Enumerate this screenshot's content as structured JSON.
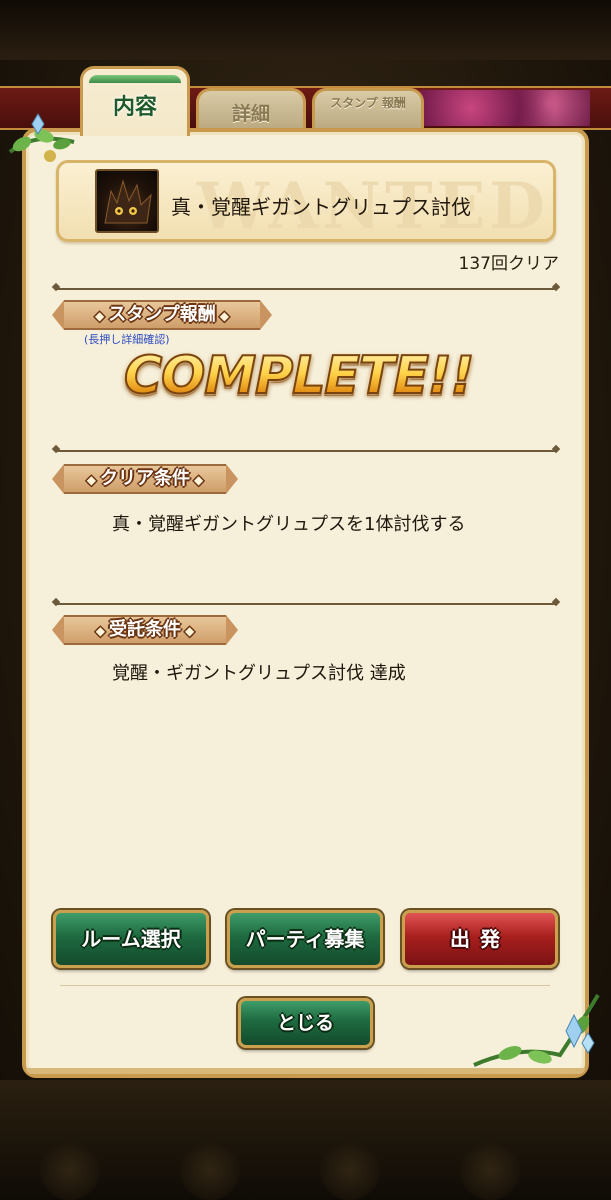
{
  "tabs": [
    {
      "label": "内容",
      "active": true
    },
    {
      "label": "詳細",
      "active": false
    },
    {
      "label": "スタンプ 報酬",
      "active": false
    }
  ],
  "quest": {
    "title": "真・覚醒ギガントグリュプス討伐",
    "watermark": "WANTED",
    "clear_count": "137回クリア"
  },
  "stamp_reward": {
    "heading": "スタンプ報酬",
    "hint": "(長押し詳細確認)",
    "status": "COMPLETE!!"
  },
  "clear_condition": {
    "heading": "クリア条件",
    "text": "真・覚醒ギガントグリュプスを1体討伐する"
  },
  "accept_condition": {
    "heading": "受託条件",
    "text": "覚醒・ギガントグリュプス討伐 達成"
  },
  "buttons": {
    "room": "ルーム選択",
    "party": "パーティ募集",
    "depart": "出発",
    "close": "とじる"
  },
  "icons": {
    "quest": "monster-portrait-icon",
    "ribbon_marker": "diamond-icon",
    "decoration": "vine-leaf-icon"
  },
  "colors": {
    "panel": "#f6efd9",
    "frame_gold": "#c89a4e",
    "button_green": "#1e6a40",
    "button_red": "#a8201e",
    "complete_gold": "#f3b72a"
  }
}
